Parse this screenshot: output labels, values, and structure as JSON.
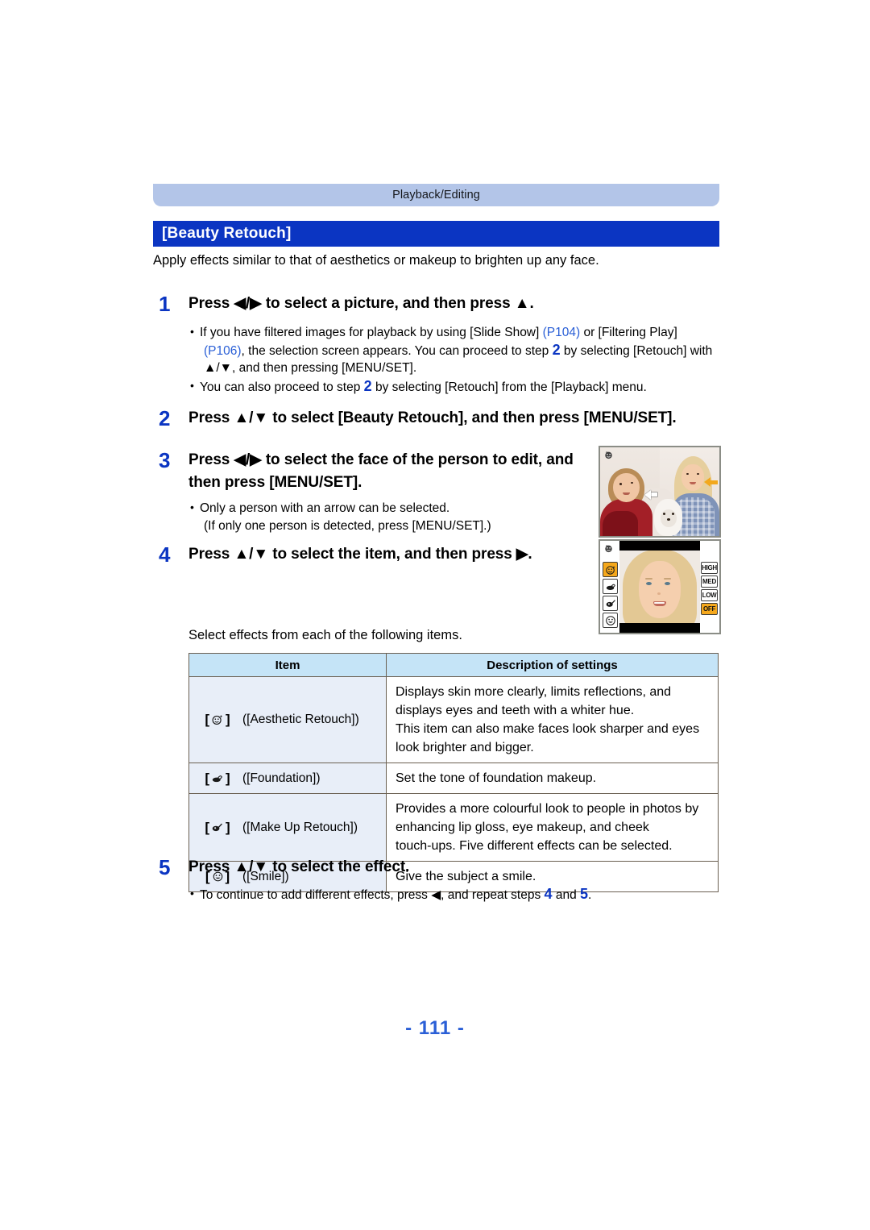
{
  "header": {
    "section_tab": "Playback/Editing",
    "title": "[Beauty Retouch]",
    "intro": "Apply effects similar to that of aesthetics or makeup to brighten up any face."
  },
  "steps": {
    "step1": {
      "number": "1",
      "text": "Press ◀/▶ to select a picture, and then press ▲.",
      "bullet1_a": "If you have filtered images for playback by using [Slide Show] ",
      "bullet1_p104": "(P104)",
      "bullet1_b": " or [Filtering Play]",
      "bullet1_p106": "(P106)",
      "bullet1_c": ", the selection screen appears. You can proceed to step ",
      "bullet1_step": "2",
      "bullet1_d": " by selecting [Retouch] with",
      "bullet1_e": "▲/▼, and then pressing [MENU/SET].",
      "bullet2_a": "You can also proceed to step ",
      "bullet2_step": "2",
      "bullet2_b": " by selecting [Retouch] from the [Playback] menu."
    },
    "step2": {
      "number": "2",
      "text": "Press ▲/▼ to select [Beauty Retouch], and then press [MENU/SET]."
    },
    "step3": {
      "number": "3",
      "line1": "Press ◀/▶ to select the face of the person to edit, and",
      "line2": "then press [MENU/SET].",
      "bullet1": "Only a person with an arrow can be selected.",
      "bullet1_cont": "(If only one person is detected, press [MENU/SET].)"
    },
    "step4": {
      "number": "4",
      "text": "Press ▲/▼ to select the item, and then press ▶."
    },
    "step5": {
      "number": "5",
      "text": "Press ▲/▼ to select the effect.",
      "bullet_a": "To continue to add different effects, press ◀, and repeat steps ",
      "bullet_step4": "4",
      "bullet_and": " and ",
      "bullet_step5": "5",
      "bullet_end": "."
    }
  },
  "screenshots": {
    "shot1": {
      "caption_icon": "retouch-mode-icon"
    },
    "shot2": {
      "menu_items": [
        {
          "name": "aesthetic-retouch",
          "selected": true
        },
        {
          "name": "foundation",
          "selected": false
        },
        {
          "name": "make-up-retouch",
          "selected": false
        },
        {
          "name": "smile",
          "selected": false
        }
      ],
      "levels": [
        {
          "label": "HIGH",
          "selected": false
        },
        {
          "label": "MED",
          "selected": false
        },
        {
          "label": "LOW",
          "selected": false
        },
        {
          "label": "OFF",
          "selected": true
        }
      ]
    }
  },
  "table": {
    "lead_in": "Select effects from each of the following items.",
    "headers": [
      "Item",
      "Description of settings"
    ],
    "rows": [
      {
        "icon": "aesthetic-retouch-icon",
        "label": "([Aesthetic Retouch])",
        "desc_line1": "Displays skin more clearly, limits reflections, and",
        "desc_line2": "displays eyes and teeth with a whiter hue.",
        "desc_line3": "This item can also make faces look sharper and eyes",
        "desc_line4": "look brighter and bigger."
      },
      {
        "icon": "foundation-icon",
        "label": "([Foundation])",
        "desc_line1": "Set the tone of foundation makeup.",
        "desc_line2": "",
        "desc_line3": "",
        "desc_line4": ""
      },
      {
        "icon": "make-up-retouch-icon",
        "label": "([Make Up Retouch])",
        "desc_line1": "Provides a more colourful look to people in photos by",
        "desc_line2": "enhancing lip gloss, eye makeup, and cheek",
        "desc_line3": "touch-ups. Five different effects can be selected.",
        "desc_line4": ""
      },
      {
        "icon": "smile-icon",
        "label": "([Smile])",
        "desc_line1": "Give the subject a smile.",
        "desc_line2": "",
        "desc_line3": "",
        "desc_line4": ""
      }
    ]
  },
  "footer": {
    "page_number": "- 111 -"
  },
  "colors": {
    "banner": "#b3c5e8",
    "title_bar": "#0b35c2",
    "step_number": "#0b35c2",
    "page_ref": "#2a5fd6",
    "table_header": "#c5e4f7",
    "table_item_cell": "#e8eef8",
    "highlight": "#f5a81c"
  }
}
